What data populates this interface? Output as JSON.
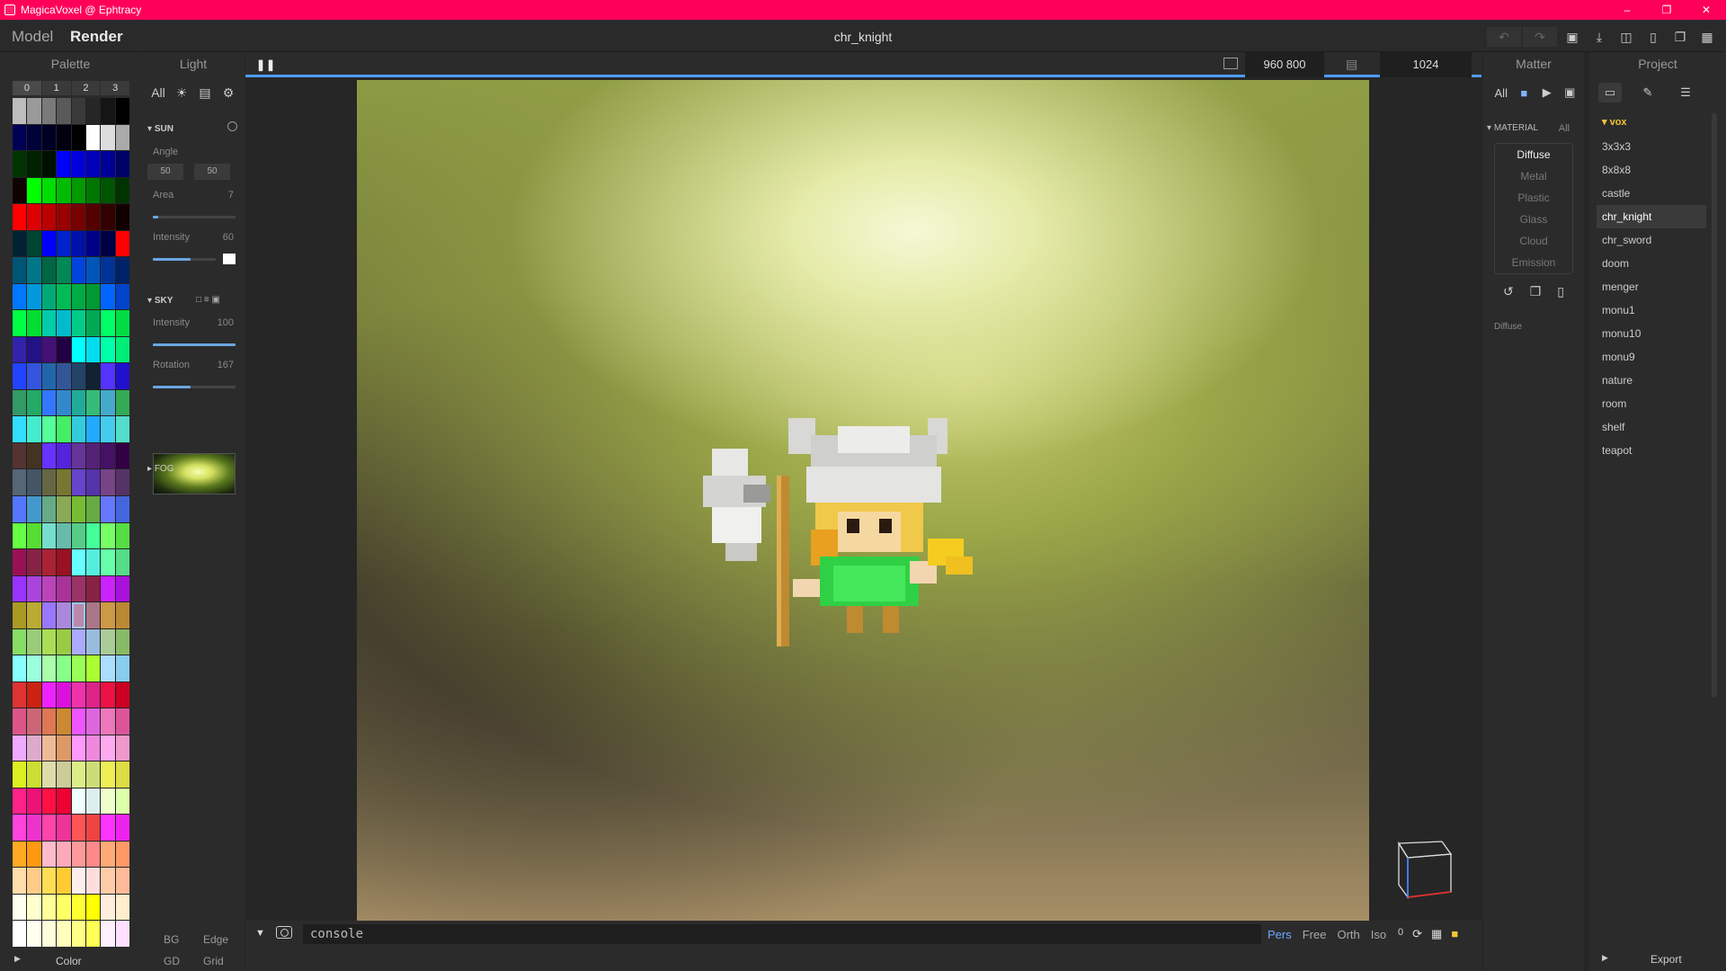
{
  "window": {
    "title": "MagicaVoxel @ Ephtracy",
    "minimize_icon": "minimize-icon",
    "restore_icon": "restore-icon",
    "close_icon": "close-icon"
  },
  "menubar": {
    "mode_model": "Model",
    "mode_render": "Render",
    "document_title": "chr_knight"
  },
  "palette": {
    "header": "Palette",
    "tabs": [
      "0",
      "1",
      "2",
      "3"
    ],
    "selected_index": 156,
    "bottom": {
      "bg": "BG",
      "edge": "Edge",
      "gd": "GD",
      "grid": "Grid"
    },
    "color_label": "Color"
  },
  "light": {
    "header": "Light",
    "tab_all": "All",
    "sun": {
      "title": "SUN",
      "angle_label": "Angle",
      "angle_1": "50",
      "angle_2": "50",
      "area_label": "Area",
      "area_value": "7",
      "area_level": 0.07,
      "intensity_label": "Intensity",
      "intensity_value": "60",
      "intensity_level": 0.6
    },
    "sky": {
      "title": "SKY",
      "intensity_label": "Intensity",
      "intensity_value": "100",
      "intensity_level": 1.0,
      "rotation_label": "Rotation",
      "rotation_value": "167",
      "rotation_level": 0.46
    },
    "fog": {
      "title": "FOG"
    }
  },
  "viewport": {
    "resolution": "960  800",
    "samples": "1024",
    "console": "console",
    "projections": [
      "Pers",
      "Free",
      "Orth",
      "Iso"
    ],
    "active_projection": "Pers",
    "zero_value": "0"
  },
  "matter": {
    "header": "Matter",
    "tab_all": "All",
    "material_title": "MATERIAL",
    "material_all": "All",
    "materials": [
      "Diffuse",
      "Metal",
      "Plastic",
      "Glass",
      "Cloud",
      "Emission"
    ],
    "selected_material": "Diffuse",
    "footer": "Diffuse"
  },
  "project": {
    "header": "Project",
    "folder": "vox",
    "files": [
      "3x3x3",
      "8x8x8",
      "castle",
      "chr_knight",
      "chr_sword",
      "doom",
      "menger",
      "monu1",
      "monu10",
      "monu9",
      "nature",
      "room",
      "shelf",
      "teapot"
    ],
    "selected_file": "chr_knight",
    "export": "Export"
  },
  "colors": {
    "titlebar": "#ff0059",
    "accent": "#4d9cff",
    "folder": "#f2c437"
  }
}
